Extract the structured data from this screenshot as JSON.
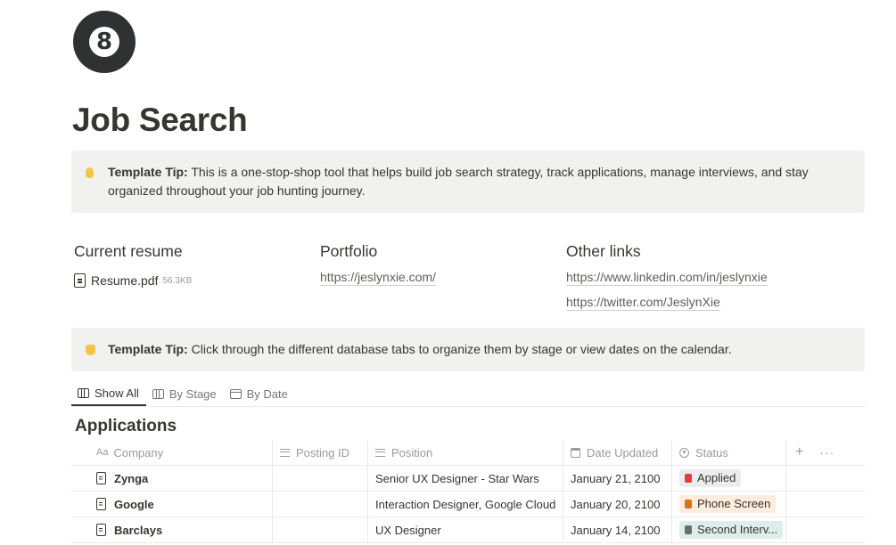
{
  "page": {
    "icon_text": "8",
    "title": "Job Search"
  },
  "callouts": [
    {
      "emoji": "lightbulb-icon",
      "label": "Template Tip:",
      "text": " This is a one-stop-shop tool that helps build job search strategy, track applications, manage interviews, and stay organized throughout your job hunting journey."
    },
    {
      "emoji": "pointing-hand-icon",
      "label": "Template Tip:",
      "text": " Click through the different database tabs to organize them by stage or view dates on the calendar."
    }
  ],
  "columns": {
    "resume": {
      "heading": "Current resume",
      "file_name": "Resume.pdf",
      "file_size": "56.3KB"
    },
    "portfolio": {
      "heading": "Portfolio",
      "link": "https://jeslynxie.com/"
    },
    "other": {
      "heading": "Other links",
      "links": [
        "https://www.linkedin.com/in/jeslynxie",
        "https://twitter.com/JeslynXie"
      ]
    }
  },
  "tabs": [
    {
      "label": "Show All",
      "icon": "table-icon",
      "active": true
    },
    {
      "label": "By Stage",
      "icon": "board-icon",
      "active": false
    },
    {
      "label": "By Date",
      "icon": "calendar-icon",
      "active": false
    }
  ],
  "database": {
    "title": "Applications",
    "headers": {
      "company_prefix": "Aa",
      "company": "Company",
      "posting_id": "Posting ID",
      "position": "Position",
      "date_updated": "Date Updated",
      "status": "Status",
      "add": "+",
      "more": "···"
    },
    "rows": [
      {
        "company": "Zynga",
        "posting_id": "",
        "position": "Senior UX Designer - Star Wars",
        "date": "January 21, 2100",
        "status": "Applied",
        "status_bg": "#ebeced",
        "status_dot": "#e03e3e"
      },
      {
        "company": "Google",
        "posting_id": "",
        "position": "Interaction Designer, Google Cloud",
        "date": "January 20, 2100",
        "status": "Phone Screen",
        "status_bg": "#fbecdd",
        "status_dot": "#d9730d"
      },
      {
        "company": "Barclays",
        "posting_id": "",
        "position": "UX Designer",
        "date": "January 14, 2100",
        "status": "Second Interv...",
        "status_bg": "#ddedea",
        "status_dot": "#6b6b6b"
      }
    ]
  }
}
